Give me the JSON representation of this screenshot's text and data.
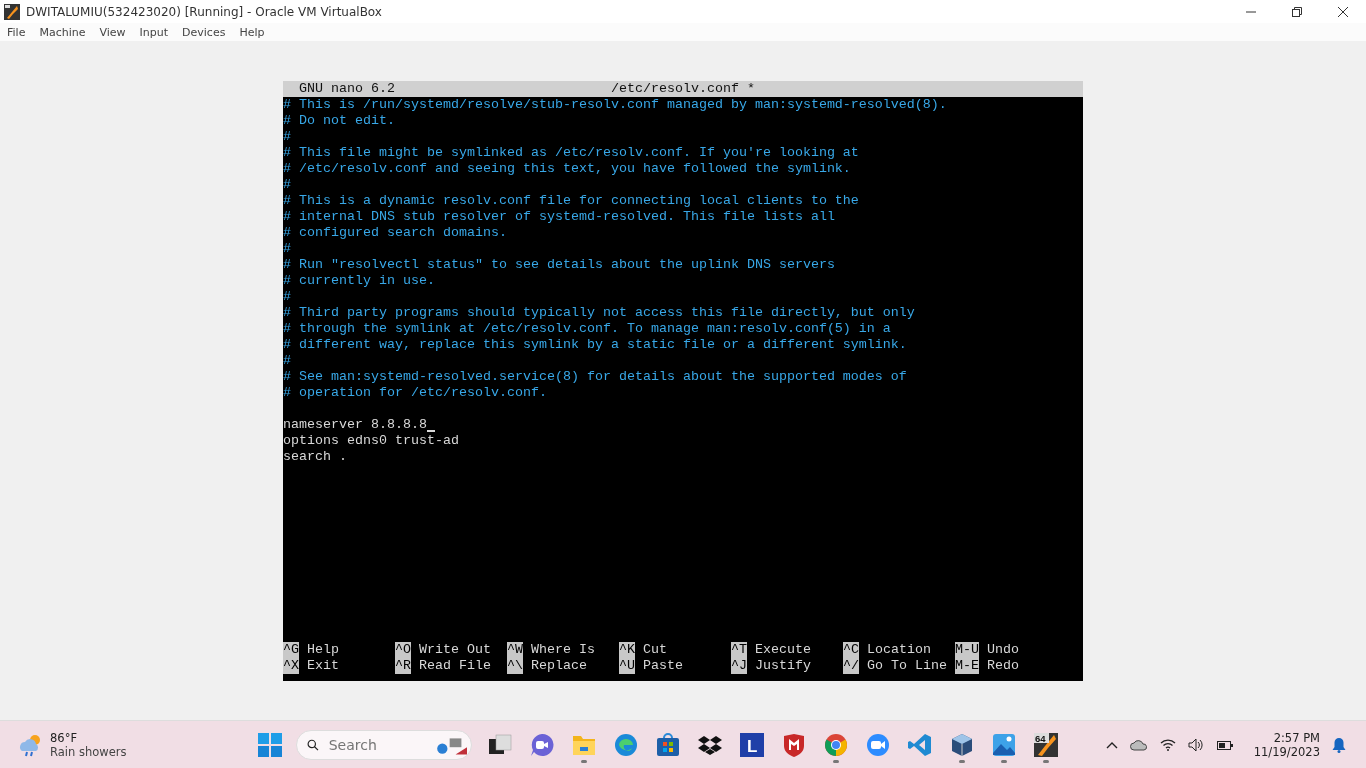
{
  "window": {
    "title": "DWITALUMIU(532423020) [Running] - Oracle VM VirtualBox"
  },
  "menu": [
    "File",
    "Machine",
    "View",
    "Input",
    "Devices",
    "Help"
  ],
  "nano": {
    "app": "GNU nano 6.2",
    "file": "/etc/resolv.conf *",
    "lines": [
      {
        "kind": "comment",
        "text": "# This is /run/systemd/resolve/stub-resolv.conf managed by man:systemd-resolved(8).",
        "cursor": false
      },
      {
        "kind": "comment",
        "text": "# Do not edit.",
        "cursor": false
      },
      {
        "kind": "comment",
        "text": "#",
        "cursor": false
      },
      {
        "kind": "comment",
        "text": "# This file might be symlinked as /etc/resolv.conf. If you're looking at",
        "cursor": false
      },
      {
        "kind": "comment",
        "text": "# /etc/resolv.conf and seeing this text, you have followed the symlink.",
        "cursor": false
      },
      {
        "kind": "comment",
        "text": "#",
        "cursor": false
      },
      {
        "kind": "comment",
        "text": "# This is a dynamic resolv.conf file for connecting local clients to the",
        "cursor": false
      },
      {
        "kind": "comment",
        "text": "# internal DNS stub resolver of systemd-resolved. This file lists all",
        "cursor": false
      },
      {
        "kind": "comment",
        "text": "# configured search domains.",
        "cursor": false
      },
      {
        "kind": "comment",
        "text": "#",
        "cursor": false
      },
      {
        "kind": "comment",
        "text": "# Run \"resolvectl status\" to see details about the uplink DNS servers",
        "cursor": false
      },
      {
        "kind": "comment",
        "text": "# currently in use.",
        "cursor": false
      },
      {
        "kind": "comment",
        "text": "#",
        "cursor": false
      },
      {
        "kind": "comment",
        "text": "# Third party programs should typically not access this file directly, but only",
        "cursor": false
      },
      {
        "kind": "comment",
        "text": "# through the symlink at /etc/resolv.conf. To manage man:resolv.conf(5) in a",
        "cursor": false
      },
      {
        "kind": "comment",
        "text": "# different way, replace this symlink by a static file or a different symlink.",
        "cursor": false
      },
      {
        "kind": "comment",
        "text": "#",
        "cursor": false
      },
      {
        "kind": "comment",
        "text": "# See man:systemd-resolved.service(8) for details about the supported modes of",
        "cursor": false
      },
      {
        "kind": "comment",
        "text": "# operation for /etc/resolv.conf.",
        "cursor": false
      },
      {
        "kind": "blank",
        "cursor": false
      },
      {
        "kind": "plain",
        "text": "nameserver 8.8.8.8",
        "cursor": true
      },
      {
        "kind": "plain",
        "text": "options edns0 trust-ad",
        "cursor": false
      },
      {
        "kind": "plain",
        "text": "search .",
        "cursor": false
      }
    ],
    "shortcuts": [
      [
        {
          "key": "^G",
          "label": "Help"
        },
        {
          "key": "^X",
          "label": "Exit"
        }
      ],
      [
        {
          "key": "^O",
          "label": "Write Out"
        },
        {
          "key": "^R",
          "label": "Read File"
        }
      ],
      [
        {
          "key": "^W",
          "label": "Where Is"
        },
        {
          "key": "^\\",
          "label": "Replace"
        }
      ],
      [
        {
          "key": "^K",
          "label": "Cut"
        },
        {
          "key": "^U",
          "label": "Paste"
        }
      ],
      [
        {
          "key": "^T",
          "label": "Execute"
        },
        {
          "key": "^J",
          "label": "Justify"
        }
      ],
      [
        {
          "key": "^C",
          "label": "Location"
        },
        {
          "key": "^/",
          "label": "Go To Line"
        }
      ],
      [
        {
          "key": "M-U",
          "label": "Undo"
        },
        {
          "key": "M-E",
          "label": "Redo"
        }
      ]
    ]
  },
  "taskbar": {
    "weather": {
      "temp": "86°F",
      "text": "Rain showers"
    },
    "search": {
      "placeholder": "Search"
    },
    "apps": [
      {
        "kind": "taskview",
        "running": false
      },
      {
        "kind": "chat",
        "running": false
      },
      {
        "kind": "folder",
        "running": true
      },
      {
        "kind": "edge",
        "running": false
      },
      {
        "kind": "store",
        "running": false
      },
      {
        "kind": "dropbox",
        "running": false
      },
      {
        "kind": "letter",
        "label": "L",
        "running": false
      },
      {
        "kind": "shield",
        "running": false
      },
      {
        "kind": "chrome",
        "running": true
      },
      {
        "kind": "zoom",
        "running": false
      },
      {
        "kind": "code",
        "running": false
      },
      {
        "kind": "cube",
        "running": true
      },
      {
        "kind": "photos",
        "running": true
      },
      {
        "kind": "vm64",
        "label": "64",
        "running": true
      }
    ],
    "time": "2:57 PM",
    "date": "11/19/2023"
  }
}
